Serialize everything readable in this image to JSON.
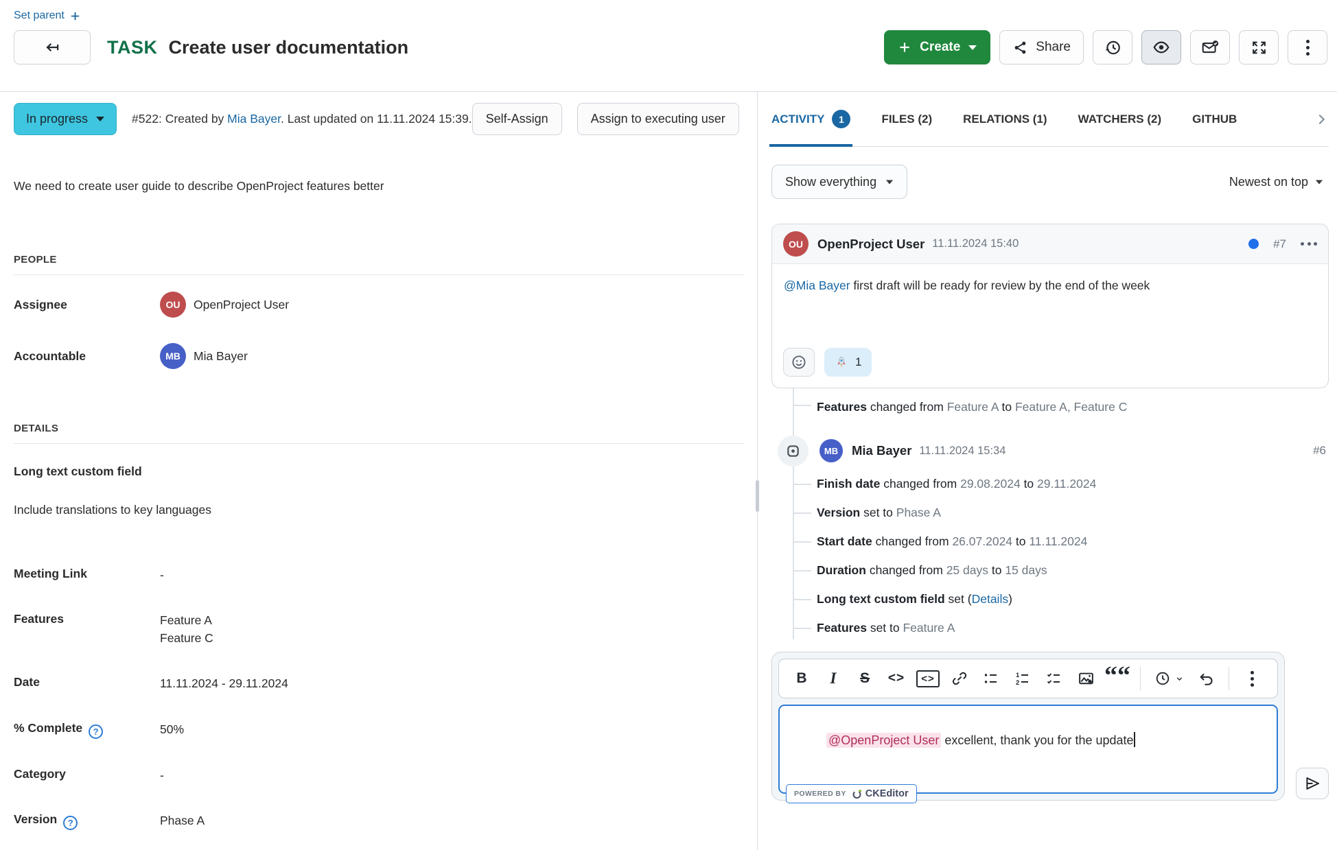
{
  "page": {
    "set_parent_label": "Set parent"
  },
  "header": {
    "type": "TASK",
    "title": "Create user documentation",
    "create_label": "Create",
    "share_label": "Share"
  },
  "status": {
    "label": "In progress",
    "meta_prefix": "#522: Created by ",
    "meta_link": "Mia Bayer",
    "meta_suffix": ". Last updated on 11.11.2024 15:39.",
    "self_assign_label": "Self-Assign",
    "assign_executing_label": "Assign to executing user"
  },
  "description": "We need to create user guide to describe OpenProject features better",
  "people": {
    "heading": "PEOPLE",
    "assignee": {
      "label": "Assignee",
      "initials": "OU",
      "name": "OpenProject User",
      "color": "#BF4D4E"
    },
    "accountable": {
      "label": "Accountable",
      "initials": "MB",
      "name": "Mia Bayer",
      "color": "#4660C8"
    }
  },
  "details": {
    "heading": "DETAILS",
    "long_text": {
      "label": "Long text custom field",
      "value": "Include translations to key languages"
    },
    "rows": [
      {
        "label": "Meeting Link",
        "value": "-"
      },
      {
        "label": "Features",
        "values": [
          "Feature A",
          "Feature C"
        ]
      },
      {
        "label": "Date",
        "value": "11.11.2024 - 29.11.2024"
      },
      {
        "label": "% Complete",
        "value": "50%"
      },
      {
        "label": "Category",
        "value": "-"
      },
      {
        "label": "Version",
        "value": "Phase A"
      }
    ]
  },
  "tabs": {
    "items": [
      {
        "label": "ACTIVITY",
        "badge": "1"
      },
      {
        "label": "FILES (2)"
      },
      {
        "label": "RELATIONS (1)"
      },
      {
        "label": "WATCHERS (2)"
      },
      {
        "label": "GITHUB"
      }
    ]
  },
  "activity": {
    "filter_label": "Show everything",
    "sort_label": "Newest on top",
    "comment7": {
      "author": "OpenProject User",
      "initials": "OU",
      "time": "11.11.2024 15:40",
      "number": "#7",
      "mention": "@Mia Bayer",
      "text": " first draft will be ready for review by the end of the week",
      "reaction": {
        "emoji": "rocket",
        "count": "1"
      }
    },
    "change7": {
      "property": "Features",
      "t1": " changed from ",
      "v1": "Feature A",
      "t2": " to ",
      "v2": "Feature A, Feature C"
    },
    "event6": {
      "author": "Mia Bayer",
      "initials": "MB",
      "time": "11.11.2024 15:34",
      "number": "#6",
      "changes": [
        {
          "property": "Finish date",
          "t1": " changed from ",
          "v1": "29.08.2024",
          "t2": " to ",
          "v2": "29.11.2024"
        },
        {
          "property": "Version",
          "t1": " set to ",
          "v1": "Phase A"
        },
        {
          "property": "Start date",
          "t1": " changed from ",
          "v1": "26.07.2024",
          "t2": " to ",
          "v2": "11.11.2024"
        },
        {
          "property": "Duration",
          "t1": " changed from ",
          "v1": "25 days",
          "t2": " to ",
          "v2": "15 days"
        },
        {
          "property": "Long text custom field",
          "t1": " set (",
          "link": "Details",
          "t3": ")"
        },
        {
          "property": "Features",
          "t1": " set to ",
          "v1": "Feature A"
        }
      ]
    }
  },
  "editor": {
    "toolbar_glyphs": {
      "bold": "B",
      "italic": "I",
      "strike": "S",
      "code": "<>",
      "code_block": "<>",
      "quote": "““"
    },
    "mention": "@OpenProject User",
    "text": " excellent, thank you for the update",
    "powered_by": "POWERED BY",
    "ckeditor": "CKEditor"
  },
  "colors": {
    "primary_blue": "#1A67A3",
    "status_in_progress": "#3EC6E0",
    "create_green": "#1F883D",
    "task_type_green": "#11714A",
    "avatar_ou": "#BF4D4E",
    "avatar_mb": "#4660C8",
    "unread_dot": "#1F6FEB",
    "mention_bg": "#FBE2EC",
    "mention_text": "#B12F56",
    "editor_focus_border": "#2E7CD6"
  }
}
